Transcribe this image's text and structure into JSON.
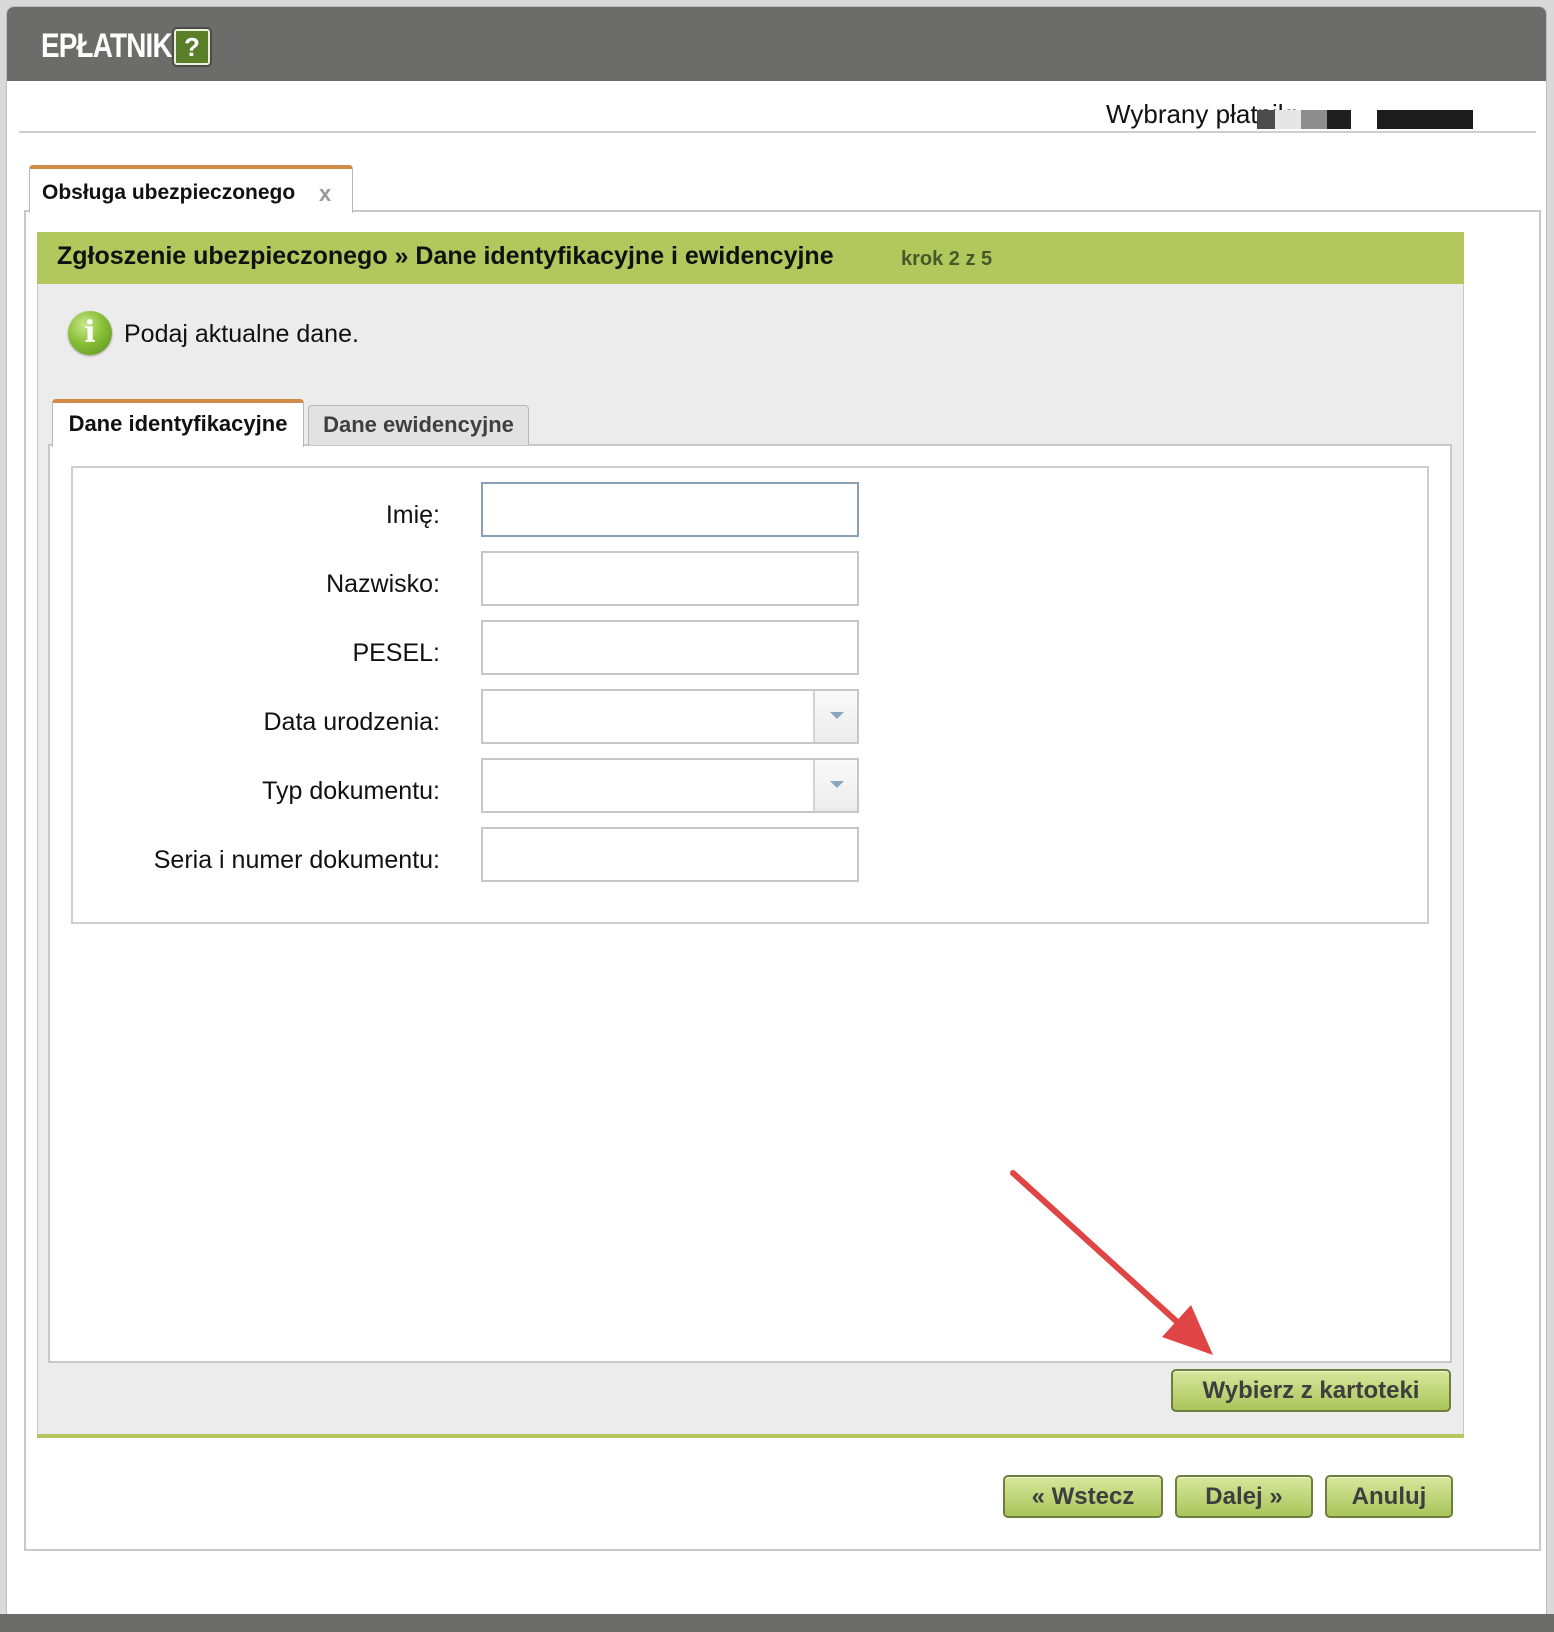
{
  "app": {
    "title": "EPŁATNIK",
    "help_glyph": "?"
  },
  "payer": {
    "label": "Wybrany płatnik:"
  },
  "outer_tab": {
    "label": "Obsługa ubezpieczonego",
    "close_glyph": "x"
  },
  "wizard": {
    "title": "Zgłoszenie ubezpieczonego » Dane identyfikacyjne i ewidencyjne",
    "step": "krok 2 z 5"
  },
  "info": {
    "icon_glyph": "i",
    "text": "Podaj aktualne dane."
  },
  "tabs": [
    {
      "label": "Dane identyfikacyjne",
      "active": true
    },
    {
      "label": "Dane ewidencyjne",
      "active": false
    }
  ],
  "form": {
    "imie": {
      "label": "Imię:",
      "value": ""
    },
    "nazwisko": {
      "label": "Nazwisko:",
      "value": ""
    },
    "pesel": {
      "label": "PESEL:",
      "value": ""
    },
    "data_urodzenia": {
      "label": "Data urodzenia:",
      "value": ""
    },
    "typ_dokumentu": {
      "label": "Typ dokumentu:",
      "value": ""
    },
    "seria_numer": {
      "label": "Seria i numer dokumentu:",
      "value": ""
    }
  },
  "buttons": {
    "kartoteka": "Wybierz z kartoteki",
    "wstecz": "« Wstecz",
    "dalej": "Dalej »",
    "anuluj": "Anuluj"
  },
  "colors": {
    "topbar": "#6c6d6b",
    "wizard_header": "#b2c85d",
    "tab_accent": "#d28b47",
    "button": "#b5cc64",
    "annotation_arrow": "#e04545"
  }
}
